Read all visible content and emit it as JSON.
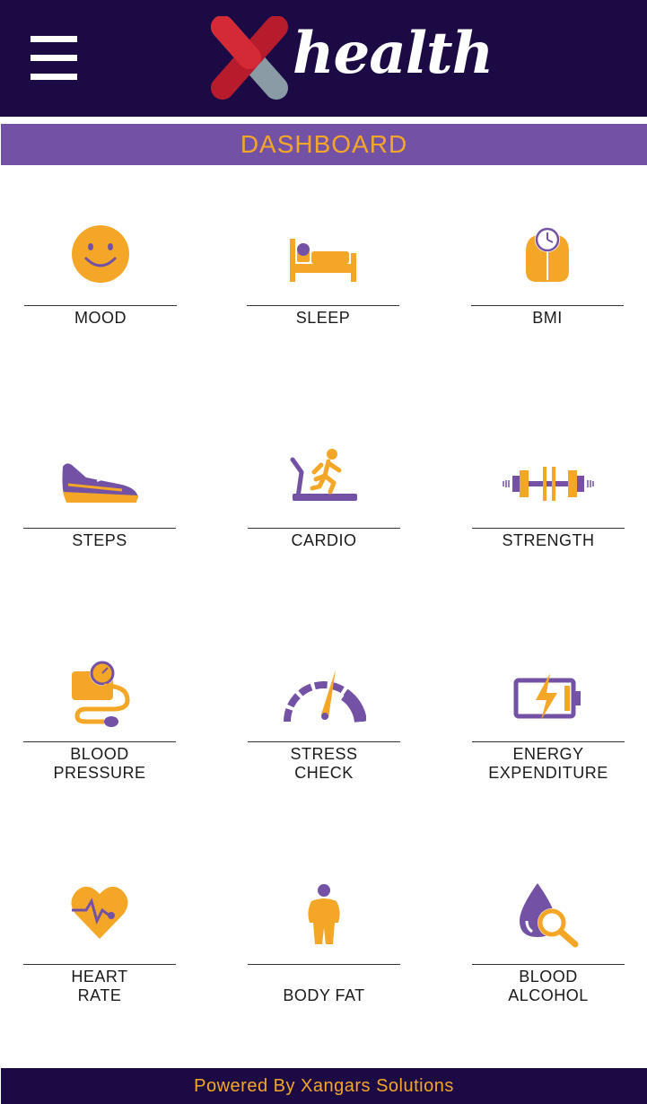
{
  "header": {
    "menu_icon": "hamburger-menu-icon",
    "logo_text": "health",
    "logo_mark": "x-cross-logo",
    "background": "#1c0a45"
  },
  "title_bar": {
    "title": "DASHBOARD",
    "background": "#7352a6",
    "text_color": "#f4a726"
  },
  "tiles": [
    {
      "label": "MOOD",
      "icon": "smiley-face-icon"
    },
    {
      "label": "SLEEP",
      "icon": "bed-icon"
    },
    {
      "label": "BMI",
      "icon": "weight-scale-icon"
    },
    {
      "label": "STEPS",
      "icon": "sneaker-icon"
    },
    {
      "label": "CARDIO",
      "icon": "treadmill-icon"
    },
    {
      "label": "STRENGTH",
      "icon": "dumbbell-icon"
    },
    {
      "label": "BLOOD\nPRESSURE",
      "icon": "blood-pressure-cuff-icon"
    },
    {
      "label": "STRESS\nCHECK",
      "icon": "speedometer-icon"
    },
    {
      "label": "ENERGY\nEXPENDITURE",
      "icon": "battery-bolt-icon"
    },
    {
      "label": "HEART\nRATE",
      "icon": "heart-pulse-icon"
    },
    {
      "label": "BODY FAT",
      "icon": "body-figure-icon"
    },
    {
      "label": "BLOOD\nALCOHOL",
      "icon": "blood-drop-magnifier-icon"
    }
  ],
  "footer": {
    "text": "Powered By Xangars Solutions"
  },
  "colors": {
    "accent_orange": "#f4a726",
    "purple": "#7352a6",
    "navy": "#1c0a45"
  }
}
